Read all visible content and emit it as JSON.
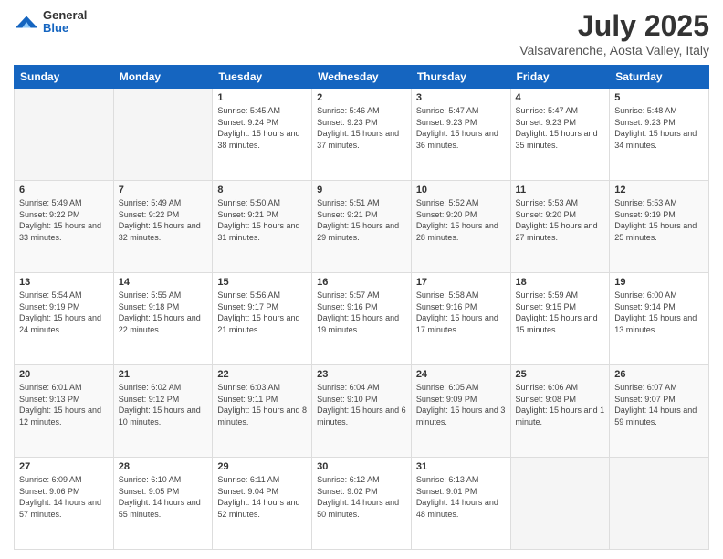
{
  "header": {
    "logo_general": "General",
    "logo_blue": "Blue",
    "title": "July 2025",
    "subtitle": "Valsavarenche, Aosta Valley, Italy"
  },
  "days_of_week": [
    "Sunday",
    "Monday",
    "Tuesday",
    "Wednesday",
    "Thursday",
    "Friday",
    "Saturday"
  ],
  "weeks": [
    [
      {
        "day": "",
        "sunrise": "",
        "sunset": "",
        "daylight": ""
      },
      {
        "day": "",
        "sunrise": "",
        "sunset": "",
        "daylight": ""
      },
      {
        "day": "1",
        "sunrise": "Sunrise: 5:45 AM",
        "sunset": "Sunset: 9:24 PM",
        "daylight": "Daylight: 15 hours and 38 minutes."
      },
      {
        "day": "2",
        "sunrise": "Sunrise: 5:46 AM",
        "sunset": "Sunset: 9:23 PM",
        "daylight": "Daylight: 15 hours and 37 minutes."
      },
      {
        "day": "3",
        "sunrise": "Sunrise: 5:47 AM",
        "sunset": "Sunset: 9:23 PM",
        "daylight": "Daylight: 15 hours and 36 minutes."
      },
      {
        "day": "4",
        "sunrise": "Sunrise: 5:47 AM",
        "sunset": "Sunset: 9:23 PM",
        "daylight": "Daylight: 15 hours and 35 minutes."
      },
      {
        "day": "5",
        "sunrise": "Sunrise: 5:48 AM",
        "sunset": "Sunset: 9:23 PM",
        "daylight": "Daylight: 15 hours and 34 minutes."
      }
    ],
    [
      {
        "day": "6",
        "sunrise": "Sunrise: 5:49 AM",
        "sunset": "Sunset: 9:22 PM",
        "daylight": "Daylight: 15 hours and 33 minutes."
      },
      {
        "day": "7",
        "sunrise": "Sunrise: 5:49 AM",
        "sunset": "Sunset: 9:22 PM",
        "daylight": "Daylight: 15 hours and 32 minutes."
      },
      {
        "day": "8",
        "sunrise": "Sunrise: 5:50 AM",
        "sunset": "Sunset: 9:21 PM",
        "daylight": "Daylight: 15 hours and 31 minutes."
      },
      {
        "day": "9",
        "sunrise": "Sunrise: 5:51 AM",
        "sunset": "Sunset: 9:21 PM",
        "daylight": "Daylight: 15 hours and 29 minutes."
      },
      {
        "day": "10",
        "sunrise": "Sunrise: 5:52 AM",
        "sunset": "Sunset: 9:20 PM",
        "daylight": "Daylight: 15 hours and 28 minutes."
      },
      {
        "day": "11",
        "sunrise": "Sunrise: 5:53 AM",
        "sunset": "Sunset: 9:20 PM",
        "daylight": "Daylight: 15 hours and 27 minutes."
      },
      {
        "day": "12",
        "sunrise": "Sunrise: 5:53 AM",
        "sunset": "Sunset: 9:19 PM",
        "daylight": "Daylight: 15 hours and 25 minutes."
      }
    ],
    [
      {
        "day": "13",
        "sunrise": "Sunrise: 5:54 AM",
        "sunset": "Sunset: 9:19 PM",
        "daylight": "Daylight: 15 hours and 24 minutes."
      },
      {
        "day": "14",
        "sunrise": "Sunrise: 5:55 AM",
        "sunset": "Sunset: 9:18 PM",
        "daylight": "Daylight: 15 hours and 22 minutes."
      },
      {
        "day": "15",
        "sunrise": "Sunrise: 5:56 AM",
        "sunset": "Sunset: 9:17 PM",
        "daylight": "Daylight: 15 hours and 21 minutes."
      },
      {
        "day": "16",
        "sunrise": "Sunrise: 5:57 AM",
        "sunset": "Sunset: 9:16 PM",
        "daylight": "Daylight: 15 hours and 19 minutes."
      },
      {
        "day": "17",
        "sunrise": "Sunrise: 5:58 AM",
        "sunset": "Sunset: 9:16 PM",
        "daylight": "Daylight: 15 hours and 17 minutes."
      },
      {
        "day": "18",
        "sunrise": "Sunrise: 5:59 AM",
        "sunset": "Sunset: 9:15 PM",
        "daylight": "Daylight: 15 hours and 15 minutes."
      },
      {
        "day": "19",
        "sunrise": "Sunrise: 6:00 AM",
        "sunset": "Sunset: 9:14 PM",
        "daylight": "Daylight: 15 hours and 13 minutes."
      }
    ],
    [
      {
        "day": "20",
        "sunrise": "Sunrise: 6:01 AM",
        "sunset": "Sunset: 9:13 PM",
        "daylight": "Daylight: 15 hours and 12 minutes."
      },
      {
        "day": "21",
        "sunrise": "Sunrise: 6:02 AM",
        "sunset": "Sunset: 9:12 PM",
        "daylight": "Daylight: 15 hours and 10 minutes."
      },
      {
        "day": "22",
        "sunrise": "Sunrise: 6:03 AM",
        "sunset": "Sunset: 9:11 PM",
        "daylight": "Daylight: 15 hours and 8 minutes."
      },
      {
        "day": "23",
        "sunrise": "Sunrise: 6:04 AM",
        "sunset": "Sunset: 9:10 PM",
        "daylight": "Daylight: 15 hours and 6 minutes."
      },
      {
        "day": "24",
        "sunrise": "Sunrise: 6:05 AM",
        "sunset": "Sunset: 9:09 PM",
        "daylight": "Daylight: 15 hours and 3 minutes."
      },
      {
        "day": "25",
        "sunrise": "Sunrise: 6:06 AM",
        "sunset": "Sunset: 9:08 PM",
        "daylight": "Daylight: 15 hours and 1 minute."
      },
      {
        "day": "26",
        "sunrise": "Sunrise: 6:07 AM",
        "sunset": "Sunset: 9:07 PM",
        "daylight": "Daylight: 14 hours and 59 minutes."
      }
    ],
    [
      {
        "day": "27",
        "sunrise": "Sunrise: 6:09 AM",
        "sunset": "Sunset: 9:06 PM",
        "daylight": "Daylight: 14 hours and 57 minutes."
      },
      {
        "day": "28",
        "sunrise": "Sunrise: 6:10 AM",
        "sunset": "Sunset: 9:05 PM",
        "daylight": "Daylight: 14 hours and 55 minutes."
      },
      {
        "day": "29",
        "sunrise": "Sunrise: 6:11 AM",
        "sunset": "Sunset: 9:04 PM",
        "daylight": "Daylight: 14 hours and 52 minutes."
      },
      {
        "day": "30",
        "sunrise": "Sunrise: 6:12 AM",
        "sunset": "Sunset: 9:02 PM",
        "daylight": "Daylight: 14 hours and 50 minutes."
      },
      {
        "day": "31",
        "sunrise": "Sunrise: 6:13 AM",
        "sunset": "Sunset: 9:01 PM",
        "daylight": "Daylight: 14 hours and 48 minutes."
      },
      {
        "day": "",
        "sunrise": "",
        "sunset": "",
        "daylight": ""
      },
      {
        "day": "",
        "sunrise": "",
        "sunset": "",
        "daylight": ""
      }
    ]
  ]
}
